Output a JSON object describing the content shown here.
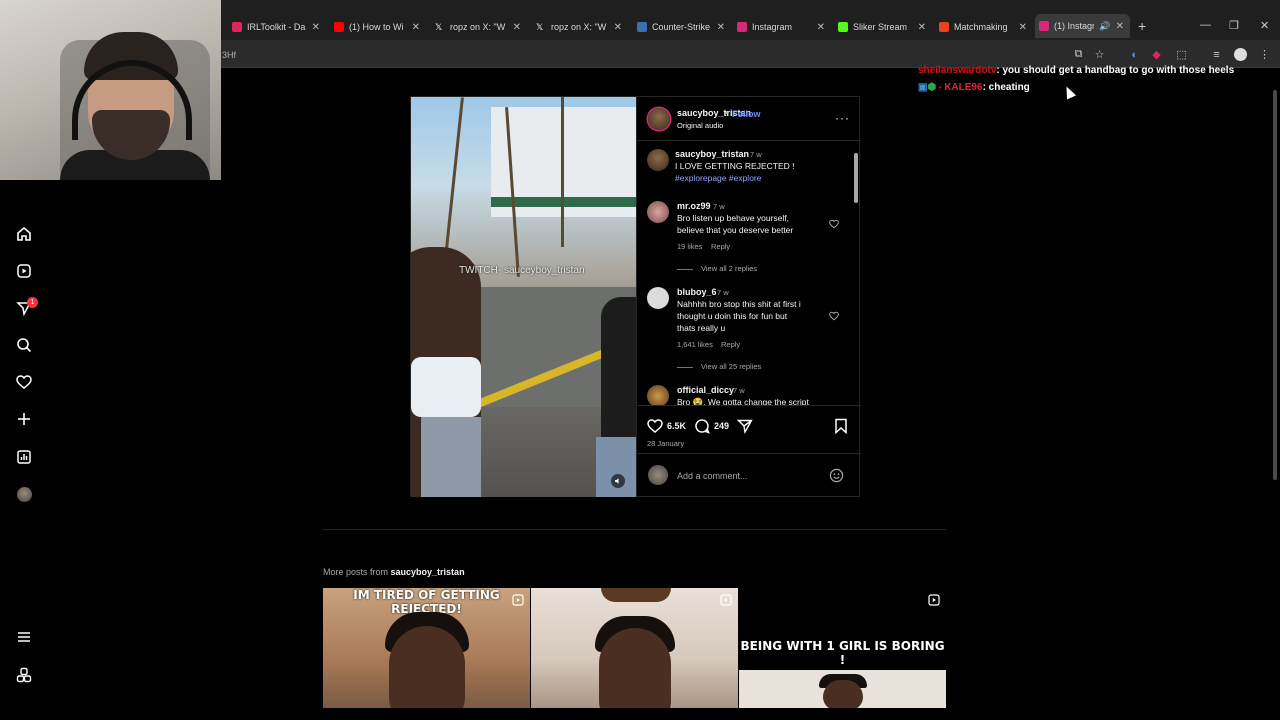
{
  "browser": {
    "tabs": [
      {
        "title": "IRLToolkit - Da",
        "color": "#e0245e"
      },
      {
        "title": "(1) How to Wi",
        "color": "#ff0000"
      },
      {
        "title": "ropz on X: \"W",
        "color": "#ffffff"
      },
      {
        "title": "ropz on X: \"W",
        "color": "#ffffff"
      },
      {
        "title": "Counter-Strike",
        "color": "#3b6fb6"
      },
      {
        "title": "Instagram",
        "color": "#d62976"
      },
      {
        "title": "Sliker Stream",
        "color": "#53fc18"
      },
      {
        "title": "Matchmaking",
        "color": "#e8431b"
      },
      {
        "title": "(1) Instagra",
        "color": "#d62976",
        "active": true
      }
    ],
    "url_fragment": "3Hf"
  },
  "chat": {
    "messages": [
      {
        "user": "sheilanswardotv",
        "text": ": you should get a handbag to go with those heels"
      },
      {
        "user": "KALE96",
        "text": ": cheating"
      }
    ]
  },
  "post": {
    "author": "saucyboy_tristan",
    "follow_label": "Follow",
    "audio": "Original audio",
    "watermark": "TWITCH- sauceyboy_tristan",
    "caption": {
      "user": "saucyboy_tristan",
      "age": "7 w",
      "text": "I LOVE GETTING REJECTED !",
      "hashtags": "#explorepage #explore"
    },
    "comments": [
      {
        "user": "mr.oz99",
        "age": "7 w",
        "text_lines": [
          "Bro listen up behave yourself,",
          "believe that you deserve better"
        ],
        "likes": "19 likes",
        "reply": "Reply",
        "view_replies": "View all 2 replies"
      },
      {
        "user": "bluboy_6",
        "age": "7 w",
        "text_lines": [
          "Nahhhh bro stop this shit at first i",
          "thought u doin this for fun but",
          "thats really u"
        ],
        "likes": "1,641 likes",
        "reply": "Reply",
        "view_replies": "View all 25 replies"
      },
      {
        "user": "official_diccy",
        "age": "7 w",
        "text_lines": [
          "Bro 😭. We gotta change the script"
        ]
      }
    ],
    "likes": "6.5K",
    "comment_count": "249",
    "date": "28 January",
    "add_comment_placeholder": "Add a comment..."
  },
  "more_posts": {
    "prefix": "More posts from ",
    "user": "saucyboy_tristan",
    "thumbs": [
      {
        "caption": "IM TIRED OF GETTING REJECTED!"
      },
      {
        "caption": ""
      },
      {
        "caption": "BEING WITH 1 GIRL IS BORING !"
      }
    ]
  },
  "nav": {
    "badge": "1",
    "items": [
      "home-icon",
      "reels-icon",
      "messages-icon",
      "search-icon",
      "notifications-icon",
      "create-icon",
      "dashboard-icon",
      "profile-avatar",
      "menu-icon",
      "threads-icon"
    ]
  },
  "colors": {
    "link_blue": "#6e8dfb",
    "hashtag": "#8ea8ff",
    "badge_red": "#ff3040",
    "chat_user_red": "#d4141a"
  }
}
